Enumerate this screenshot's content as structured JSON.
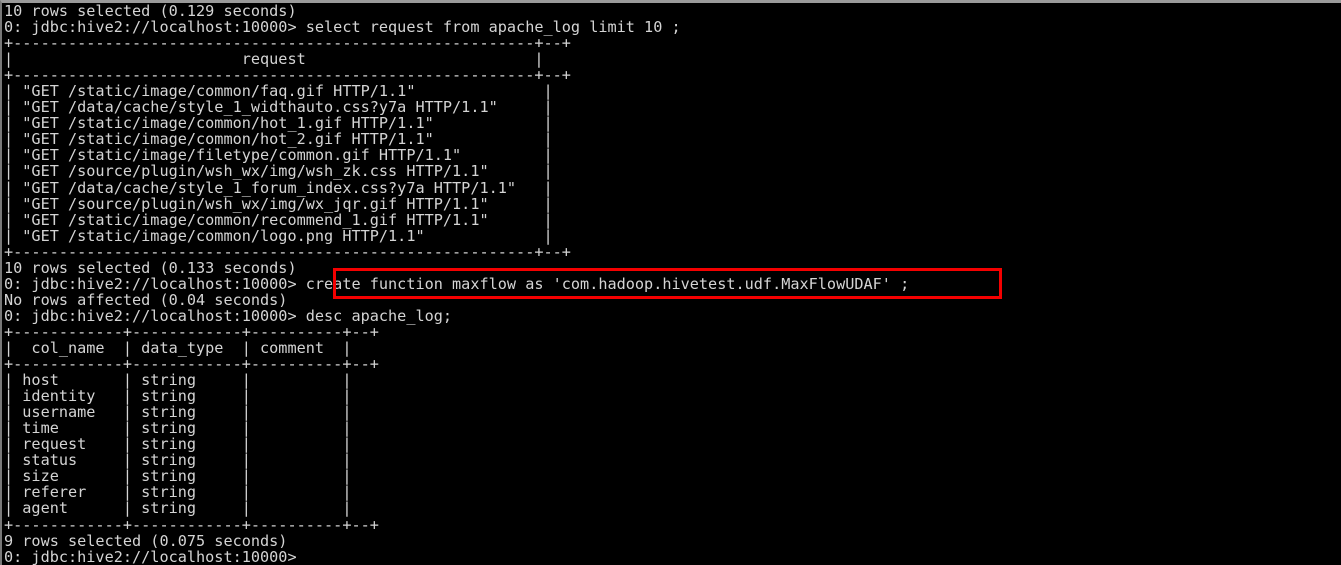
{
  "terminal": {
    "title": "beeline-hive2-session",
    "background_color": "#000000",
    "text_color": "#d4d4d4",
    "highlight_color": "#f40000",
    "border_color": "#9a9a9a",
    "prompt": "0: jdbc:hive2://localhost:10000>"
  },
  "lines": [
    {
      "id": "l01",
      "text": "10 rows selected (0.129 seconds)"
    },
    {
      "id": "l02",
      "text": "0: jdbc:hive2://localhost:10000> select request from apache_log limit 10 ;"
    },
    {
      "id": "l03",
      "text": "+---------------------------------------------------------+--+"
    },
    {
      "id": "l04",
      "text": "|                         request                         |"
    },
    {
      "id": "l05",
      "text": "+---------------------------------------------------------+--+"
    },
    {
      "id": "l06",
      "text": "| \"GET /static/image/common/faq.gif HTTP/1.1\"              |"
    },
    {
      "id": "l07",
      "text": "| \"GET /data/cache/style_1_widthauto.css?y7a HTTP/1.1\"     |"
    },
    {
      "id": "l08",
      "text": "| \"GET /static/image/common/hot_1.gif HTTP/1.1\"            |"
    },
    {
      "id": "l09",
      "text": "| \"GET /static/image/common/hot_2.gif HTTP/1.1\"            |"
    },
    {
      "id": "l10",
      "text": "| \"GET /static/image/filetype/common.gif HTTP/1.1\"         |"
    },
    {
      "id": "l11",
      "text": "| \"GET /source/plugin/wsh_wx/img/wsh_zk.css HTTP/1.1\"      |"
    },
    {
      "id": "l12",
      "text": "| \"GET /data/cache/style_1_forum_index.css?y7a HTTP/1.1\"   |"
    },
    {
      "id": "l13",
      "text": "| \"GET /source/plugin/wsh_wx/img/wx_jqr.gif HTTP/1.1\"      |"
    },
    {
      "id": "l14",
      "text": "| \"GET /static/image/common/recommend_1.gif HTTP/1.1\"      |"
    },
    {
      "id": "l15",
      "text": "| \"GET /static/image/common/logo.png HTTP/1.1\"             |"
    },
    {
      "id": "l16",
      "text": "+---------------------------------------------------------+--+"
    },
    {
      "id": "l17",
      "text": "10 rows selected (0.133 seconds)"
    },
    {
      "id": "l18",
      "text": "0: jdbc:hive2://localhost:10000> create function maxflow as 'com.hadoop.hivetest.udf.MaxFlowUDAF' ;"
    },
    {
      "id": "l19",
      "text": "No rows affected (0.04 seconds)"
    },
    {
      "id": "l20",
      "text": "0: jdbc:hive2://localhost:10000> desc apache_log;"
    },
    {
      "id": "l21",
      "text": "+------------+------------+----------+--+"
    },
    {
      "id": "l22",
      "text": "|  col_name  | data_type  | comment  |"
    },
    {
      "id": "l23",
      "text": "+------------+------------+----------+--+"
    },
    {
      "id": "l24",
      "text": "| host       | string     |          |"
    },
    {
      "id": "l25",
      "text": "| identity   | string     |          |"
    },
    {
      "id": "l26",
      "text": "| username   | string     |          |"
    },
    {
      "id": "l27",
      "text": "| time       | string     |          |"
    },
    {
      "id": "l28",
      "text": "| request    | string     |          |"
    },
    {
      "id": "l29",
      "text": "| status     | string     |          |"
    },
    {
      "id": "l30",
      "text": "| size       | string     |          |"
    },
    {
      "id": "l31",
      "text": "| referer    | string     |          |"
    },
    {
      "id": "l32",
      "text": "| agent      | string     |          |"
    },
    {
      "id": "l33",
      "text": "+------------+------------+----------+--+"
    },
    {
      "id": "l34",
      "text": "9 rows selected (0.075 seconds)"
    },
    {
      "id": "l35",
      "text": "0: jdbc:hive2://localhost:10000>"
    }
  ],
  "queries": {
    "select_request": "select request from apache_log limit 10 ;",
    "create_function": "create function maxflow as 'com.hadoop.hivetest.udf.MaxFlowUDAF' ;",
    "desc_table": "desc apache_log;"
  },
  "results": {
    "select_status_before": "10 rows selected (0.129 seconds)",
    "select_status_after": "10 rows selected (0.133 seconds)",
    "create_function_status": "No rows affected (0.04 seconds)",
    "desc_status": "9 rows selected (0.075 seconds)"
  },
  "request_table": {
    "header": "request",
    "rows": [
      "\"GET /static/image/common/faq.gif HTTP/1.1\"",
      "\"GET /data/cache/style_1_widthauto.css?y7a HTTP/1.1\"",
      "\"GET /static/image/common/hot_1.gif HTTP/1.1\"",
      "\"GET /static/image/common/hot_2.gif HTTP/1.1\"",
      "\"GET /static/image/filetype/common.gif HTTP/1.1\"",
      "\"GET /source/plugin/wsh_wx/img/wsh_zk.css HTTP/1.1\"",
      "\"GET /data/cache/style_1_forum_index.css?y7a HTTP/1.1\"",
      "\"GET /source/plugin/wsh_wx/img/wx_jqr.gif HTTP/1.1\"",
      "\"GET /static/image/common/recommend_1.gif HTTP/1.1\"",
      "\"GET /static/image/common/logo.png HTTP/1.1\""
    ]
  },
  "desc_table": {
    "columns": [
      "col_name",
      "data_type",
      "comment"
    ],
    "rows": [
      [
        "host",
        "string",
        ""
      ],
      [
        "identity",
        "string",
        ""
      ],
      [
        "username",
        "string",
        ""
      ],
      [
        "time",
        "string",
        ""
      ],
      [
        "request",
        "string",
        ""
      ],
      [
        "status",
        "string",
        ""
      ],
      [
        "size",
        "string",
        ""
      ],
      [
        "referer",
        "string",
        ""
      ],
      [
        "agent",
        "string",
        ""
      ]
    ]
  },
  "annotation": {
    "highlight_target": "create function maxflow as 'com.hadoop.hivetest.udf.MaxFlowUDAF' ;",
    "color": "#f40000"
  }
}
